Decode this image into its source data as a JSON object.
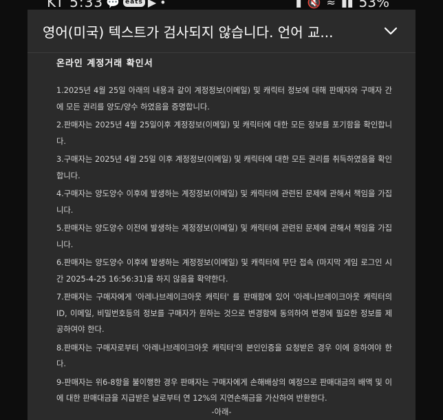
{
  "status_bar": {
    "time": "KT 5:33",
    "battery": "53%",
    "app_badge": "eats"
  },
  "header": {
    "title": "영어(미국) 텍스트가 검사되지 않습니다. 언어 교..."
  },
  "document": {
    "title": "온라인 계정거래 확인서",
    "clauses": [
      "1.2025년 4월 25일 아래의 내용과 같이 계정정보(이메일) 및 캐릭터 정보에 대해 판매자와 구매자 간에 모든 권리를 양도/양수 하였음을 증명합니다.",
      "2.판매자는 2025년 4월 25일이후 계정정보(이메일) 및 캐릭터에 대한 모든 정보를 포기함을 확인합니다.",
      "3.구매자는 2025년 4월 25일 이후 계정정보(이메일) 및 캐릭터에 대한 모든 권리를 취득하였음을 확인합니다.",
      "4.구매자는 양도양수 이후에 발생하는 계정정보(이메일) 및 캐릭터에 관련된 문제에 관해서 책임을 가집니다.",
      "5.판매자는 양도양수 이전에 발생하는 계정정보(이메일) 및 캐릭터에 관련된 문제에 관해서 책임을 가집니다.",
      "6.판매자는 양도양수 이후에 발생하는 계정정보(이메일) 및 캐릭터에 무단 접속 (마지막 게임 로그인 시간 2025-4-25 16:56:31)을 하지 않음을 확약한다.",
      "7.판매자는 구매자에게 '아레나브레이크아웃 캐릭터' 를 판매함에 있어 '아레나브레이크아웃 캐릭터의 ID, 이메일, 비밀번호등의 정보를 구매자가 원하는 것으로 변경함에 동의하여 변경에 필요한 정보를 제공하여야 한다.",
      "8.판매자는 구매자로부터 '아레나브레이크아웃 캐릭터'의 본인인증을 요청받은 경우 이에 응하여야 한다.",
      "9-판매자는 위6-8항을 불이행한 경우 판매자는 구매자에게 손해배상의 예정으로 판매대금의 배액 및 이에 대한 판매대금을 지급받은 날로부터 연 12%의 지연손해금을 가산하여 반환한다."
    ],
    "footer_mark": "-아래-"
  },
  "colors": {
    "sheet_background": "#2b2b2b",
    "page_background": "#0d0d0d",
    "text": "#d6d6d6"
  },
  "icons": {
    "header_action": "chevron-down-icon"
  }
}
